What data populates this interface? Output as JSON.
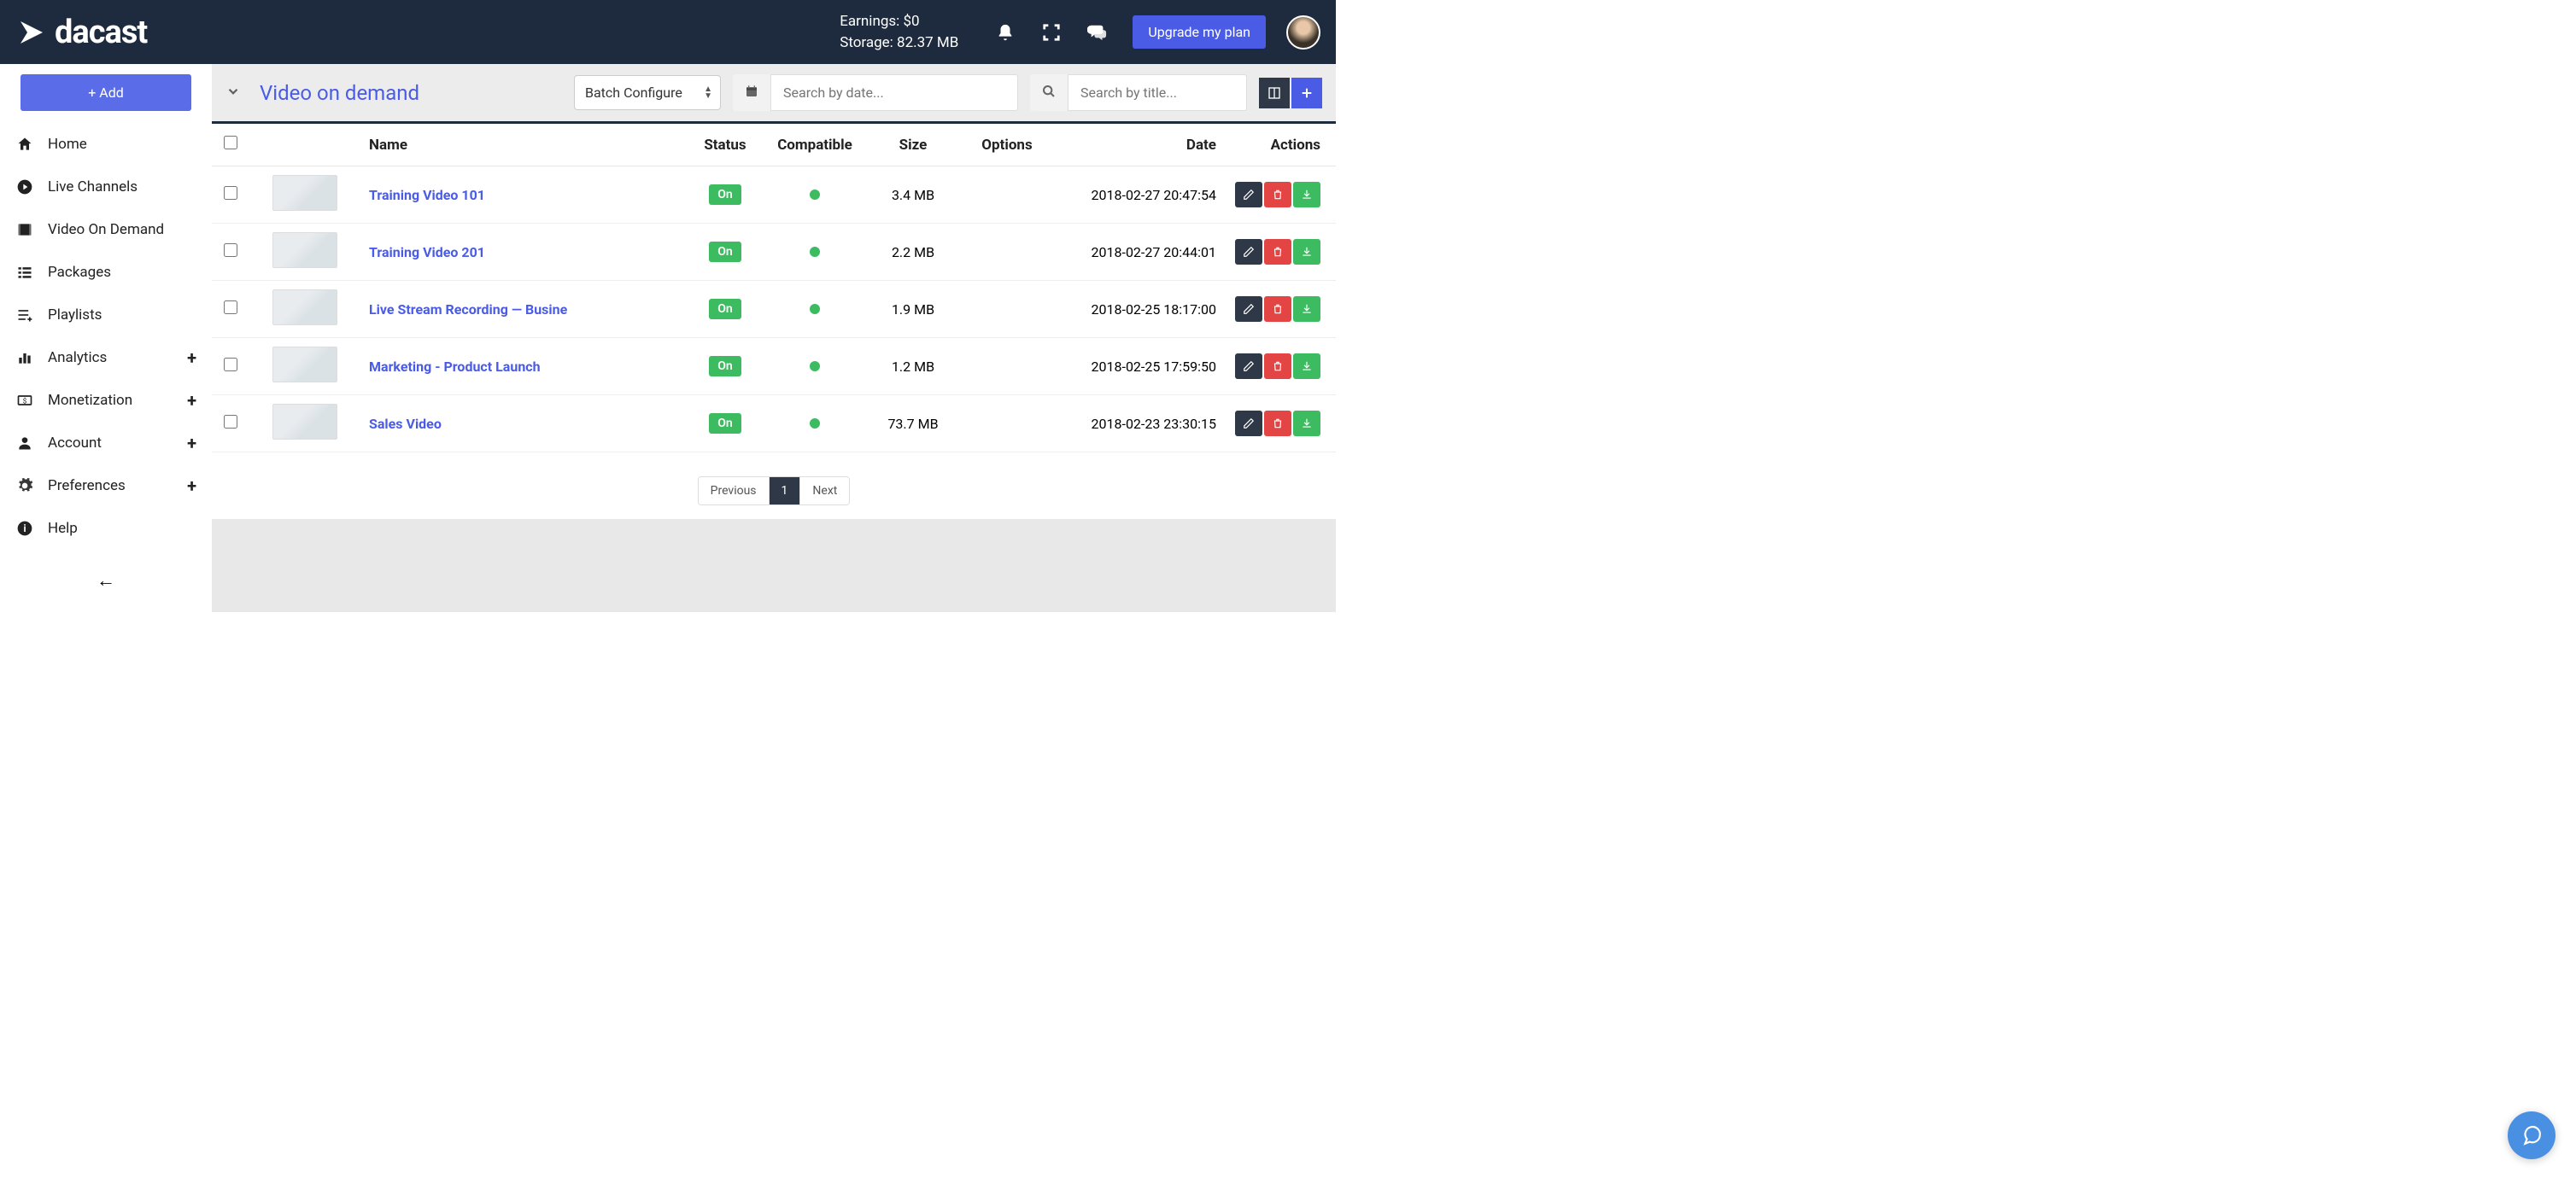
{
  "brand": "dacast",
  "header": {
    "earnings_label": "Earnings:",
    "earnings_value": "$0",
    "storage_label": "Storage:",
    "storage_value": "82.37 MB",
    "upgrade_label": "Upgrade my plan"
  },
  "sidebar": {
    "add_label": "+ Add",
    "items": [
      {
        "label": "Home",
        "icon": "home"
      },
      {
        "label": "Live Channels",
        "icon": "play-circle"
      },
      {
        "label": "Video On Demand",
        "icon": "film"
      },
      {
        "label": "Packages",
        "icon": "list"
      },
      {
        "label": "Playlists",
        "icon": "playlist"
      },
      {
        "label": "Analytics",
        "icon": "bar-chart",
        "expandable": true
      },
      {
        "label": "Monetization",
        "icon": "dollar",
        "expandable": true
      },
      {
        "label": "Account",
        "icon": "person",
        "expandable": true
      },
      {
        "label": "Preferences",
        "icon": "gear",
        "expandable": true
      },
      {
        "label": "Help",
        "icon": "info"
      }
    ]
  },
  "toolbar": {
    "page_title": "Video on demand",
    "batch_label": "Batch Configure",
    "date_placeholder": "Search by date...",
    "title_placeholder": "Search by title..."
  },
  "table": {
    "headers": {
      "name": "Name",
      "status": "Status",
      "compatible": "Compatible",
      "size": "Size",
      "options": "Options",
      "date": "Date",
      "actions": "Actions"
    },
    "rows": [
      {
        "name": "Training Video 101",
        "status": "On",
        "size": "3.4 MB",
        "date": "2018-02-27 20:47:54"
      },
      {
        "name": "Training Video 201",
        "status": "On",
        "size": "2.2 MB",
        "date": "2018-02-27 20:44:01"
      },
      {
        "name": "Live Stream Recording — Busine",
        "status": "On",
        "size": "1.9 MB",
        "date": "2018-02-25 18:17:00"
      },
      {
        "name": "Marketing - Product Launch",
        "status": "On",
        "size": "1.2 MB",
        "date": "2018-02-25 17:59:50"
      },
      {
        "name": "Sales Video",
        "status": "On",
        "size": "73.7 MB",
        "date": "2018-02-23 23:30:15"
      }
    ]
  },
  "pagination": {
    "prev": "Previous",
    "current": "1",
    "next": "Next"
  }
}
